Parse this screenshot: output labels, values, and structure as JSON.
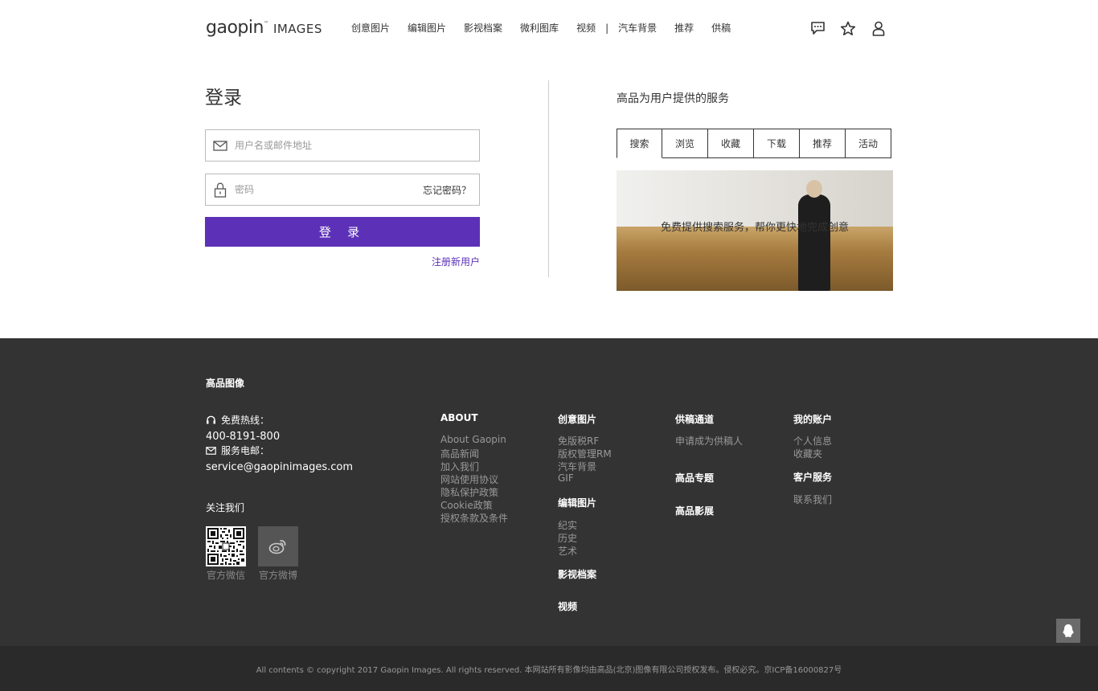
{
  "header": {
    "logo_brand": "gaopin",
    "logo_tm": "™",
    "logo_images": "IMAGES",
    "nav": [
      "创意图片",
      "编辑图片",
      "影视档案",
      "微利图库",
      "视频",
      "汽车背景",
      "推荐",
      "供稿"
    ],
    "nav_separator": "|",
    "icons": [
      "message-icon",
      "star-icon",
      "user-icon"
    ]
  },
  "login": {
    "title": "登录",
    "username_placeholder": "用户名或邮件地址",
    "password_placeholder": "密码",
    "forgot": "忘记密码？",
    "submit": "登 录",
    "register": "注册新用户"
  },
  "services": {
    "title": "高品为用户提供的服务",
    "tabs": [
      "搜索",
      "浏览",
      "收藏",
      "下载",
      "推荐",
      "活动"
    ],
    "active_tab": "搜索",
    "caption": "免费提供搜索服务，帮你更快地完成创意"
  },
  "footer": {
    "brand": "高品图像",
    "hotline_label": "免费热线：",
    "hotline": "400-8191-800",
    "email_label": "服务电邮：",
    "email": "service@gaopinimages.com",
    "follow": "关注我们",
    "wechat": "官方微信",
    "weibo": "官方微博",
    "about": {
      "head": "ABOUT",
      "links": [
        "About Gaopin",
        "高品新闻",
        "加入我们",
        "网站使用协议",
        "隐私保护政策",
        "Cookie政策",
        "授权条款及条件"
      ]
    },
    "creative": {
      "head": "创意图片",
      "links": [
        "免版税RF",
        "版权管理RM",
        "汽车背景",
        "GIF"
      ]
    },
    "editorial": {
      "head": "编辑图片",
      "links": [
        "纪实",
        "历史",
        "艺术"
      ]
    },
    "film": "影视档案",
    "video": "视频",
    "contribute": {
      "head": "供稿通道",
      "links": [
        "申请成为供稿人"
      ]
    },
    "topics": "高品专题",
    "exhibition": "高品影展",
    "account": {
      "head": "我的账户",
      "links": [
        "个人信息",
        "收藏夹"
      ]
    },
    "service": {
      "head": "客户服务",
      "links": [
        "联系我们"
      ]
    },
    "copyright": "All contents © copyright 2017 Gaopin Images. All rights reserved. 本网站所有影像均由高品(北京)图像有限公司授权发布。侵权必究。京ICP备16000827号"
  },
  "colors": {
    "accent": "#5c31b8",
    "footer_bg": "#333333",
    "bottom_bar_bg": "#2a2a2a"
  }
}
